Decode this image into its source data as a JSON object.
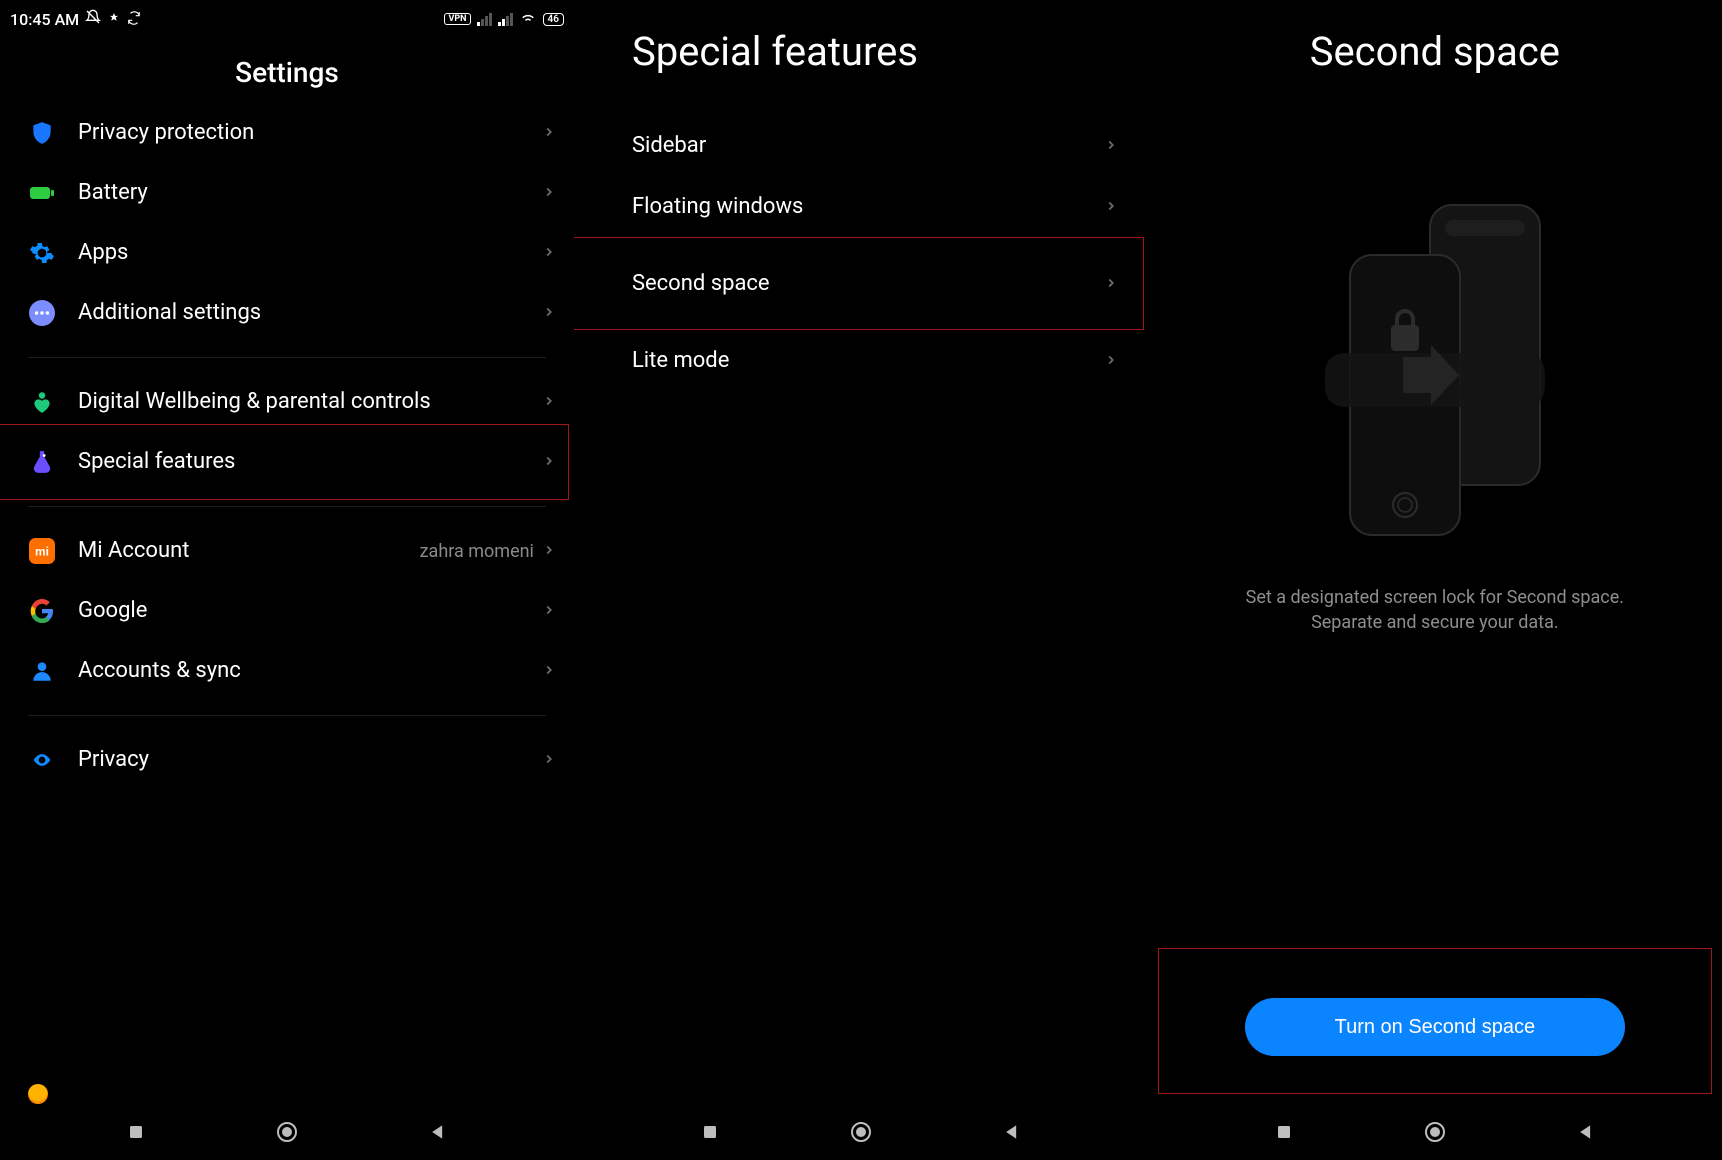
{
  "status": {
    "time": "10:45 AM",
    "vpn": "VPN",
    "battery": "46"
  },
  "screen1": {
    "title": "Settings",
    "items": [
      {
        "label": "Privacy protection"
      },
      {
        "label": "Battery"
      },
      {
        "label": "Apps"
      },
      {
        "label": "Additional settings"
      },
      {
        "label": "Digital Wellbeing & parental controls"
      },
      {
        "label": "Special features"
      },
      {
        "label": "Mi Account",
        "sub": "zahra momeni"
      },
      {
        "label": "Google"
      },
      {
        "label": "Accounts & sync"
      },
      {
        "label": "Privacy"
      }
    ]
  },
  "screen2": {
    "title": "Special features",
    "items": [
      {
        "label": "Sidebar"
      },
      {
        "label": "Floating windows"
      },
      {
        "label": "Second space"
      },
      {
        "label": "Lite mode"
      }
    ]
  },
  "screen3": {
    "title": "Second space",
    "desc1": "Set a designated screen lock for Second space.",
    "desc2": "Separate and secure your data.",
    "cta": "Turn on Second space"
  }
}
